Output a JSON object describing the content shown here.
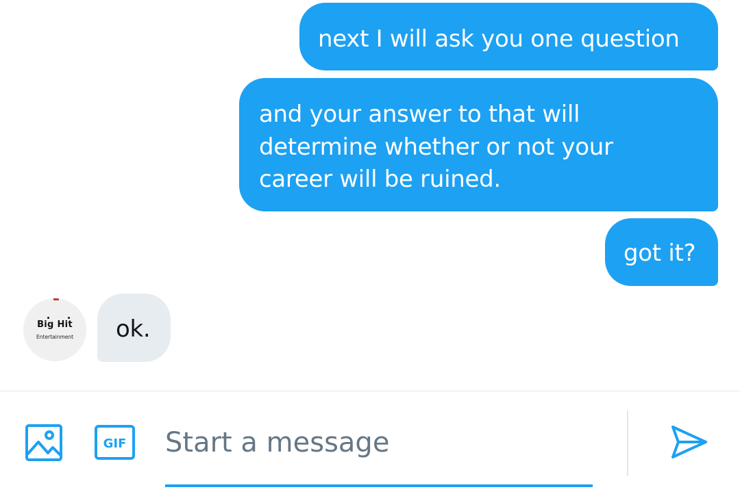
{
  "conversation": {
    "messages": [
      {
        "sender": "me",
        "lines": [
          "next I will ask you one question"
        ]
      },
      {
        "sender": "me",
        "lines": [
          "and your answer to that will",
          "determine whether or not your",
          "career will be ruined."
        ]
      },
      {
        "sender": "me",
        "lines": [
          "got it?"
        ]
      },
      {
        "sender": "other",
        "lines": [
          "ok."
        ]
      }
    ]
  },
  "avatar": {
    "logo_main": "Big Hit",
    "logo_sub": "Entertainment"
  },
  "composer": {
    "placeholder": "Start a message",
    "gif_label": "GIF",
    "icons": {
      "image": "image-icon",
      "gif": "gif-icon",
      "send": "send-icon"
    }
  },
  "colors": {
    "accent": "#1da1f2",
    "received_bubble": "#e6ecf0",
    "placeholder": "#657786",
    "divider": "#e1e8ed"
  }
}
